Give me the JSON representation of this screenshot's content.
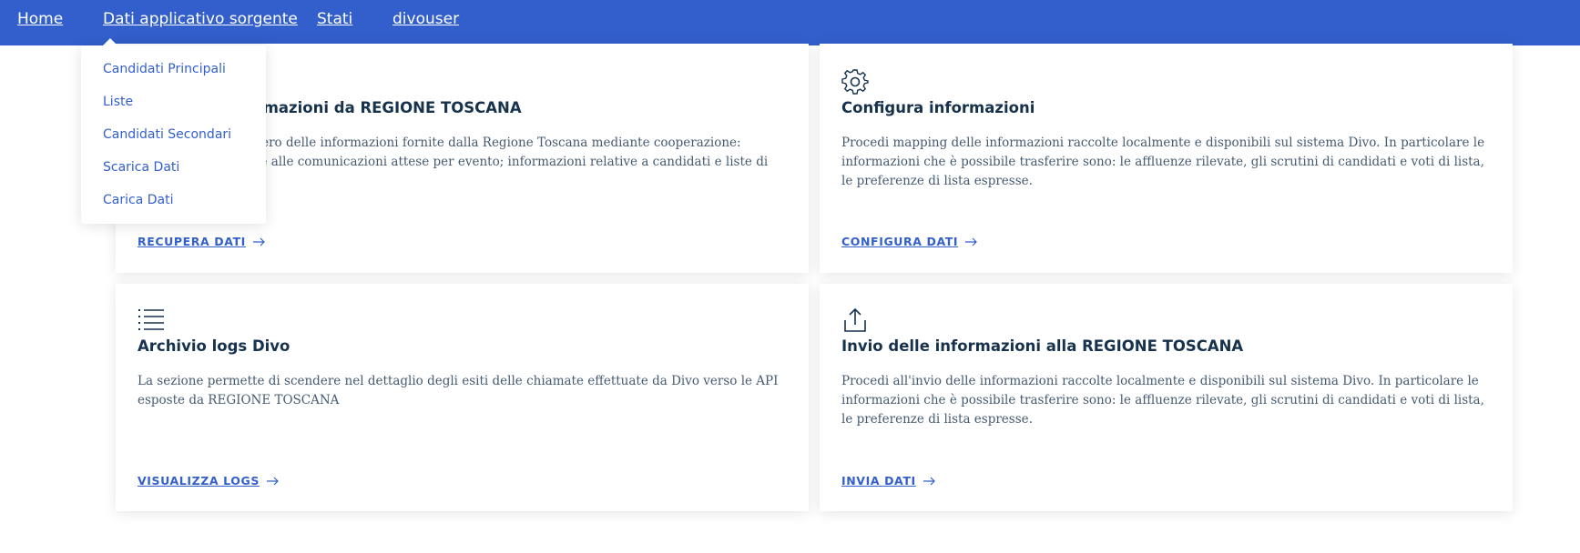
{
  "nav": {
    "items": [
      {
        "label": "Home"
      },
      {
        "label": "Dati applicativo sorgente"
      },
      {
        "label": "Stati"
      },
      {
        "label": "divouser"
      }
    ]
  },
  "dropdown": {
    "items": [
      {
        "label": "Candidati Principali"
      },
      {
        "label": "Liste"
      },
      {
        "label": "Candidati Secondari"
      },
      {
        "label": "Scarica Dati"
      },
      {
        "label": "Carica Dati"
      }
    ]
  },
  "cards": [
    {
      "icon": "download-icon",
      "title": "Recupero informazioni da REGIONE TOSCANA",
      "description": "Procedi per il recupero delle informazioni fornite dalla Regione Toscana mediante cooperazione: informazioni relative alle comunicazioni attese per evento; informazioni relative a candidati e liste di",
      "cta": "RECUPERA DATI"
    },
    {
      "icon": "gear-icon",
      "title": "Configura informazioni",
      "description": "Procedi mapping delle informazioni raccolte localmente e disponibili sul sistema Divo. In particolare le informazioni che è possibile trasferire sono: le affluenze rilevate, gli scrutini di candidati e voti di lista, le preferenze di lista espresse.",
      "cta": "CONFIGURA DATI"
    },
    {
      "icon": "list-icon",
      "title": "Archivio logs Divo",
      "description": "La sezione permette di scendere nel dettaglio degli esiti delle chiamate effettuate da Divo verso le API esposte da REGIONE TOSCANA",
      "cta": "VISUALIZZA LOGS"
    },
    {
      "icon": "upload-icon",
      "title": "Invio delle informazioni alla REGIONE TOSCANA",
      "description": "Procedi all'invio delle informazioni raccolte localmente e disponibili sul sistema Divo. In particolare le informazioni che è possibile trasferire sono: le affluenze rilevate, gli scrutini di candidati e voti di lista, le preferenze di lista espresse.",
      "cta": "INVIA DATI"
    }
  ],
  "colors": {
    "primary": "#325fcc",
    "title": "#17324d",
    "text": "#455b71"
  }
}
